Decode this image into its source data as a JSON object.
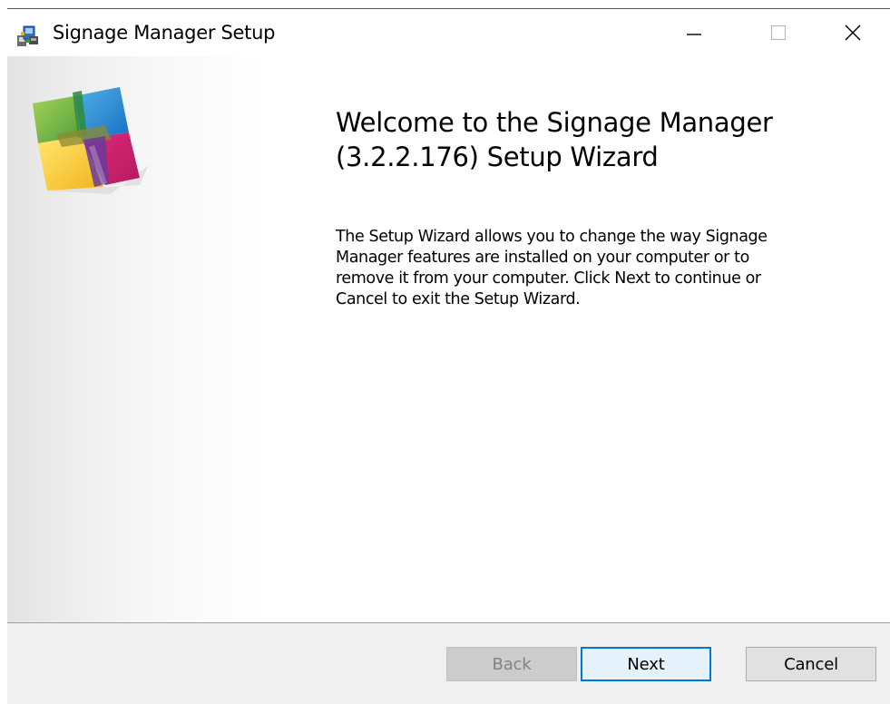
{
  "window": {
    "title": "Signage Manager Setup"
  },
  "titlebar_buttons": {
    "minimize_icon": "minimize-icon",
    "maximize_icon": "maximize-icon",
    "close_icon": "close-icon"
  },
  "welcome": {
    "title_line1": "Welcome to the Signage Manager",
    "title_line2": "(3.2.2.176) Setup Wizard",
    "description_lines": [
      "The Setup Wizard allows you to change the way Signage",
      "Manager features are installed on your computer or to",
      "remove it from your computer. Click Next to continue or",
      "Cancel to exit the Setup Wizard."
    ]
  },
  "buttons": {
    "back": "Back",
    "next": "Next",
    "cancel": "Cancel"
  },
  "colors": {
    "focus_accent": "#0078d7",
    "footer_background": "#f0f0f0",
    "disabled_text": "#838383"
  }
}
